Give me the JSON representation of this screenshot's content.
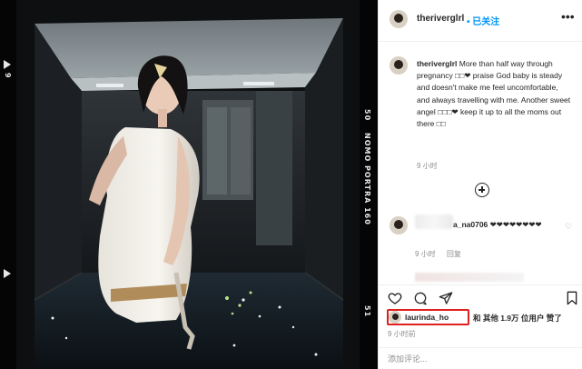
{
  "photo": {
    "film_top_number": "9",
    "film_mid_number": "50",
    "film_brand": "NOMO PORTRA 160",
    "film_bottom_number": "51"
  },
  "header": {
    "username": "theriverglrl",
    "follow_label": "• 已关注",
    "more_icon": "more-horizontal-icon"
  },
  "caption": {
    "username": "theriverglrl",
    "text": "More than half way through pregnancy □□❤ praise God baby is steady and doesn't make me feel uncomfortable, and always travelling with me. Another sweet angel □□□❤ keep it up to all the moms out there □□",
    "time": "9 小时"
  },
  "load_more_icon": "plus-circle-icon",
  "comment": {
    "username_suffix": "a_na0706",
    "text": "❤❤❤❤❤❤❤❤",
    "meta_time": "9 小时",
    "meta_reply": "回复"
  },
  "actions": {
    "like_icon": "heart-icon",
    "comment_icon": "comment-icon",
    "share_icon": "send-icon",
    "save_icon": "bookmark-icon"
  },
  "likes": {
    "user": "laurinda_ho",
    "text": "和 其他 1.9万 位用户 赞了",
    "highlight_color": "#e0201e"
  },
  "post_time": "9 小时前",
  "comment_box": {
    "placeholder": "添加评论..."
  }
}
